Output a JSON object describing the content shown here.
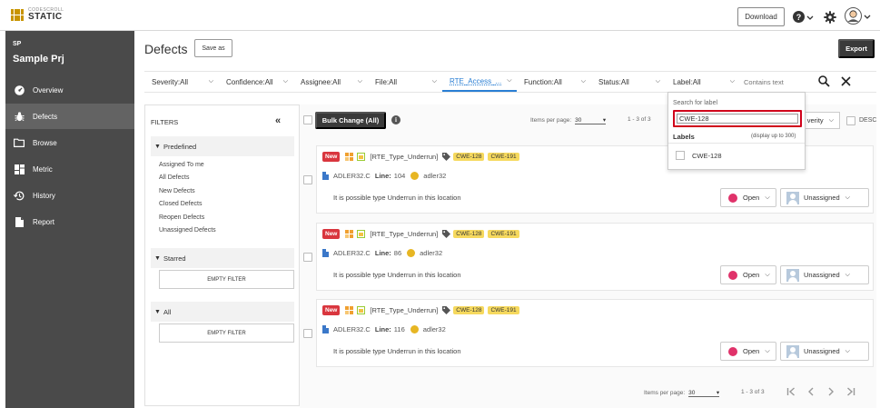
{
  "app": {
    "logo_small": "CODESCROLL",
    "logo_big": "STATIC",
    "download_label": "Download"
  },
  "project": {
    "code": "SP",
    "name": "Sample Prj"
  },
  "nav": [
    {
      "label": "Overview",
      "icon": "speedometer-icon"
    },
    {
      "label": "Defects",
      "icon": "bug-icon"
    },
    {
      "label": "Browse",
      "icon": "folder-icon"
    },
    {
      "label": "Metric",
      "icon": "dashboard-icon"
    },
    {
      "label": "History",
      "icon": "history-icon"
    },
    {
      "label": "Report",
      "icon": "document-icon"
    }
  ],
  "page": {
    "title": "Defects",
    "save_as": "Save as",
    "export": "Export"
  },
  "filterbar": {
    "items": [
      "Severity:All",
      "Confidence:All",
      "Assignee:All",
      "File:All",
      "RTE_Access_...",
      "Function:All",
      "Status:All",
      "Label:All"
    ],
    "contains_placeholder": "Contains text"
  },
  "filters_panel": {
    "title": "FILTERS",
    "predefined_title": "Predefined",
    "predefined": [
      "Assigned To me",
      "All Defects",
      "New Defects",
      "Closed Defects",
      "Reopen Defects",
      "Unassigned Defects"
    ],
    "starred_title": "Starred",
    "all_title": "All",
    "empty_filter": "EMPTY FILTER"
  },
  "list": {
    "bulk_change": "Bulk Change (All)",
    "items_per_page_label": "Items per page:",
    "items_per_page": "30",
    "range": "1 - 3 of 3",
    "sort_label": "verity",
    "desc_label": "DESC"
  },
  "defects": [
    {
      "badge": "New",
      "rule": "[RTE_Type_Underrun]",
      "labels": [
        "CWE-128",
        "CWE-191"
      ],
      "file": "ADLER32.C",
      "line_label": "Line:",
      "line": "104",
      "function": "adler32",
      "message": "It is possible type Underrun in this location",
      "status": "Open",
      "assignee": "Unassigned"
    },
    {
      "badge": "New",
      "rule": "[RTE_Type_Underrun]",
      "labels": [
        "CWE-128",
        "CWE-191"
      ],
      "file": "ADLER32.C",
      "line_label": "Line:",
      "line": "86",
      "function": "adler32",
      "message": "It is possible type Underrun in this location",
      "status": "Open",
      "assignee": "Unassigned"
    },
    {
      "badge": "New",
      "rule": "[RTE_Type_Underrun]",
      "labels": [
        "CWE-128",
        "CWE-191"
      ],
      "file": "ADLER32.C",
      "line_label": "Line:",
      "line": "116",
      "function": "adler32",
      "message": "It is possible type Underrun in this location",
      "status": "Open",
      "assignee": "Unassigned"
    }
  ],
  "label_popup": {
    "title": "Search for label",
    "search_value": "CWE-128",
    "labels_title": "Labels",
    "hint": "(display up to 300)",
    "options": [
      "CWE-128"
    ]
  },
  "colors": {
    "sidebar": "#4a4a4a",
    "accent_red": "#d0021b",
    "status_open": "#e0326a",
    "label_bg": "#f6d95e"
  }
}
